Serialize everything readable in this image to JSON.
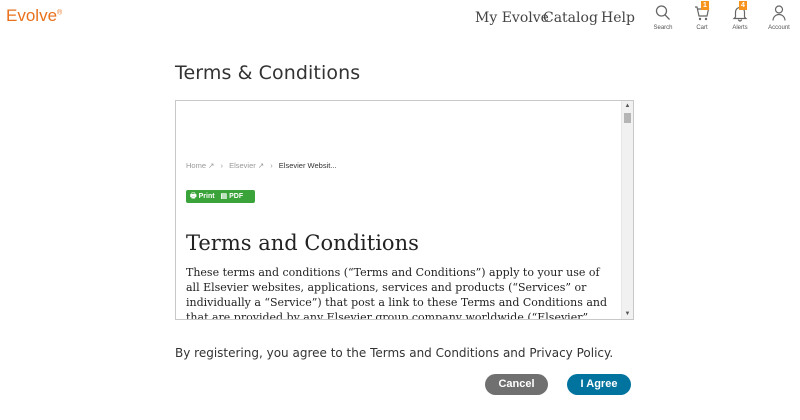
{
  "app": {
    "logo": "Evolve",
    "logo_mark": "®",
    "brand_color": "#e9711c"
  },
  "nav": {
    "my_evolve": "My Evolve",
    "catalog": "Catalog",
    "help": "Help"
  },
  "icons": {
    "search": {
      "label": "Search",
      "icon": "search-icon"
    },
    "cart": {
      "label": "Cart",
      "icon": "cart-icon",
      "badge": "1"
    },
    "alerts": {
      "label": "Alerts",
      "icon": "bell-icon",
      "badge": "4"
    },
    "account": {
      "label": "Account",
      "icon": "user-icon"
    }
  },
  "page": {
    "title": "Terms & Conditions"
  },
  "tc": {
    "breadcrumb": {
      "home": "Home ↗",
      "elsevier": "Elsevier ↗",
      "current": "Elsevier Websit...",
      "sep": "›"
    },
    "print_label": "Print",
    "pdf_label": "PDF",
    "doc_title": "Terms and Conditions",
    "body": "These terms and conditions (“Terms and Conditions”) apply to your use of all Elsevier websites, applications, services and products (“Services” or individually a “Service”) that post a link to these Terms and Conditions and that are provided by any Elsevier group company worldwide (“Elsevier”, “we”, “us” or “our”)."
  },
  "consent_text": "By registering, you agree to the Terms and Conditions and Privacy Policy.",
  "buttons": {
    "cancel": "Cancel",
    "agree": "I Agree"
  },
  "colors": {
    "cancel": "#707070",
    "agree": "#00739e",
    "badge": "#f7941d",
    "print": "#3aa33a"
  }
}
